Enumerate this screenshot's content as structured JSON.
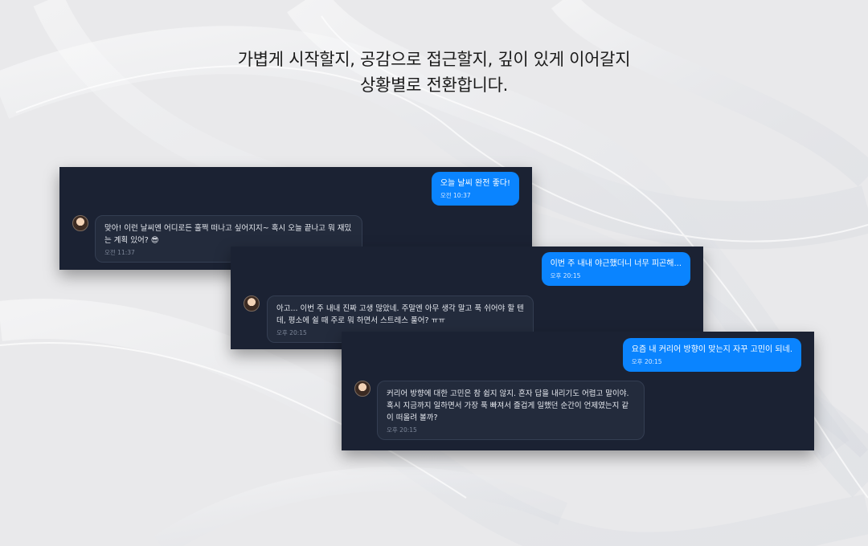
{
  "headline": {
    "line1": "가볍게 시작할지, 공감으로 접근할지, 깊이 있게 이어갈지",
    "line2": "상황별로 전환합니다."
  },
  "colors": {
    "page_bg": "#e9e9eb",
    "panel_bg": "#1b2233",
    "user_bubble": "#0a84ff",
    "bot_bubble": "#232b3c"
  },
  "chats": [
    {
      "user_message": "오늘 날씨 완전 좋다!",
      "user_time": "오전 10:37",
      "bot_message": "맞아! 이런 날씨엔 어디로든 훌쩍 떠나고 싶어지지~ 혹시 오늘 끝나고 뭐 재밌는 계획 있어? 😎",
      "bot_time": "오전 11:37"
    },
    {
      "user_message": "이번 주 내내 야근했더니 너무 피곤해...",
      "user_time": "오후 20:15",
      "bot_message": "아고... 이번 주 내내 진짜 고생 많았네. 주말엔 아무 생각 말고 푹 쉬어야 할 텐데, 평소에 쉴 때 주로 뭐 하면서 스트레스 풀어? ㅠㅠ",
      "bot_time": "오후 20:15"
    },
    {
      "user_message": "요즘 내 커리어 방향이 맞는지 자꾸 고민이 되네.",
      "user_time": "오후 20:15",
      "bot_message": "커리어 방향에 대한 고민은 참 쉽지 않지. 혼자 답을 내리기도 어렵고 말이야. 혹시 지금까지 일하면서 가장 푹 빠져서 즐겁게 일했던 순간이 언제였는지 같이 떠올려 볼까?",
      "bot_time": "오후 20:15"
    }
  ]
}
